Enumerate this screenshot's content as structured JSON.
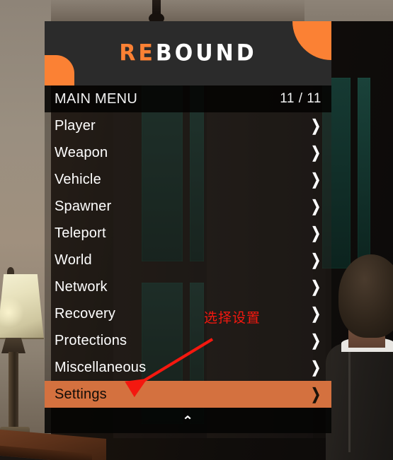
{
  "app": {
    "logo_prefix": "RE",
    "logo_suffix": "BOUND"
  },
  "menu": {
    "title": "MAIN MENU",
    "count": "11 / 11",
    "chevron_right": "❯",
    "footer_chevron_up": "⌃",
    "items": [
      {
        "label": "Player",
        "selected": false
      },
      {
        "label": "Weapon",
        "selected": false
      },
      {
        "label": "Vehicle",
        "selected": false
      },
      {
        "label": "Spawner",
        "selected": false
      },
      {
        "label": "Teleport",
        "selected": false
      },
      {
        "label": "World",
        "selected": false
      },
      {
        "label": "Network",
        "selected": false
      },
      {
        "label": "Recovery",
        "selected": false
      },
      {
        "label": "Protections",
        "selected": false
      },
      {
        "label": "Miscellaneous",
        "selected": false
      },
      {
        "label": "Settings",
        "selected": true
      }
    ]
  },
  "annotation": {
    "text": "选择设置",
    "color": "#f4180f"
  },
  "colors": {
    "accent_orange": "#fb8134",
    "selected_row": "#d4713f",
    "header_bg": "#2b2b2b",
    "title_bar_bg": "#050403",
    "row_text": "#ffffff"
  }
}
